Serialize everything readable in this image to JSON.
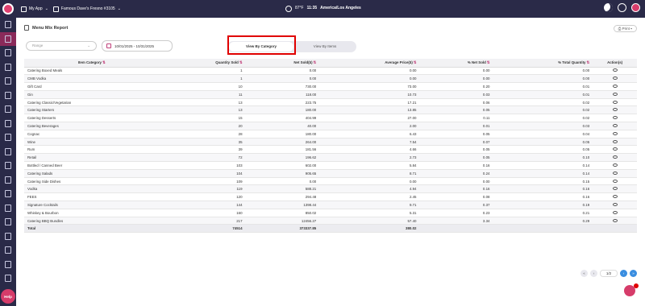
{
  "topbar": {
    "app": "My App",
    "store": "Famous Dave's Fresno #3105",
    "temp": "87°F",
    "time": "11:35",
    "timezone": "America/Los Angeles"
  },
  "page": {
    "title": "Menu Mix Report",
    "print": "Print"
  },
  "filters": {
    "range": "Range",
    "date": "10/01/2025 - 10/31/2025"
  },
  "toggle": {
    "category": "View By Category",
    "items": "View By Items"
  },
  "table": {
    "headers": [
      "Item Category",
      "Quantity Sold",
      "Net Sold($)",
      "Average Price($)",
      "% Net Sold",
      "% Total Quantity",
      "Action(s)"
    ],
    "rows": [
      [
        "Catering Boxed Meals",
        "1",
        "0.00",
        "0.00",
        "0.00",
        "0.00"
      ],
      [
        "CMB Vodka",
        "1",
        "0.00",
        "0.00",
        "0.00",
        "0.00"
      ],
      [
        "Gift Card",
        "10",
        "730.00",
        "73.00",
        "0.20",
        "0.01"
      ],
      [
        "Gin",
        "11",
        "118.00",
        "10.73",
        "0.03",
        "0.01"
      ],
      [
        "Catering Classic/Vegetarian",
        "13",
        "223.75",
        "17.21",
        "0.06",
        "0.02"
      ],
      [
        "Catering Starters",
        "13",
        "180.00",
        "13.85",
        "0.05",
        "0.02"
      ],
      [
        "Catering Desserts",
        "15",
        "404.99",
        "27.00",
        "0.11",
        "0.02"
      ],
      [
        "Catering Beverages",
        "20",
        "40.00",
        "2.00",
        "0.01",
        "0.03"
      ],
      [
        "Cognac",
        "28",
        "180.00",
        "6.43",
        "0.05",
        "0.04"
      ],
      [
        "Wine",
        "35",
        "264.00",
        "7.54",
        "0.07",
        "0.05"
      ],
      [
        "Rum",
        "39",
        "181.56",
        "4.66",
        "0.05",
        "0.05"
      ],
      [
        "Retail",
        "72",
        "196.62",
        "2.73",
        "0.05",
        "0.10"
      ],
      [
        "Bottled / Canned Beer",
        "103",
        "602.00",
        "5.84",
        "0.16",
        "0.14"
      ],
      [
        "Catering Salads",
        "104",
        "905.65",
        "8.71",
        "0.24",
        "0.14"
      ],
      [
        "Catering Side Dishes",
        "109",
        "0.00",
        "0.00",
        "0.00",
        "0.15"
      ],
      [
        "Vodka",
        "119",
        "588.21",
        "4.94",
        "0.16",
        "0.16"
      ],
      [
        "FEES",
        "120",
        "294.48",
        "2.45",
        "0.08",
        "0.16"
      ],
      [
        "Signature Cocktails",
        "144",
        "1398.44",
        "9.71",
        "0.37",
        "0.19"
      ],
      [
        "Whiskey & Bourbon",
        "160",
        "850.02",
        "5.31",
        "0.23",
        "0.21"
      ],
      [
        "Catering BBQ Bundles",
        "217",
        "12456.27",
        "57.40",
        "3.34",
        "0.29"
      ]
    ],
    "total": [
      "Total",
      "74514",
      "373337.85",
      "380.02"
    ]
  },
  "pager": {
    "page": "1/2"
  }
}
